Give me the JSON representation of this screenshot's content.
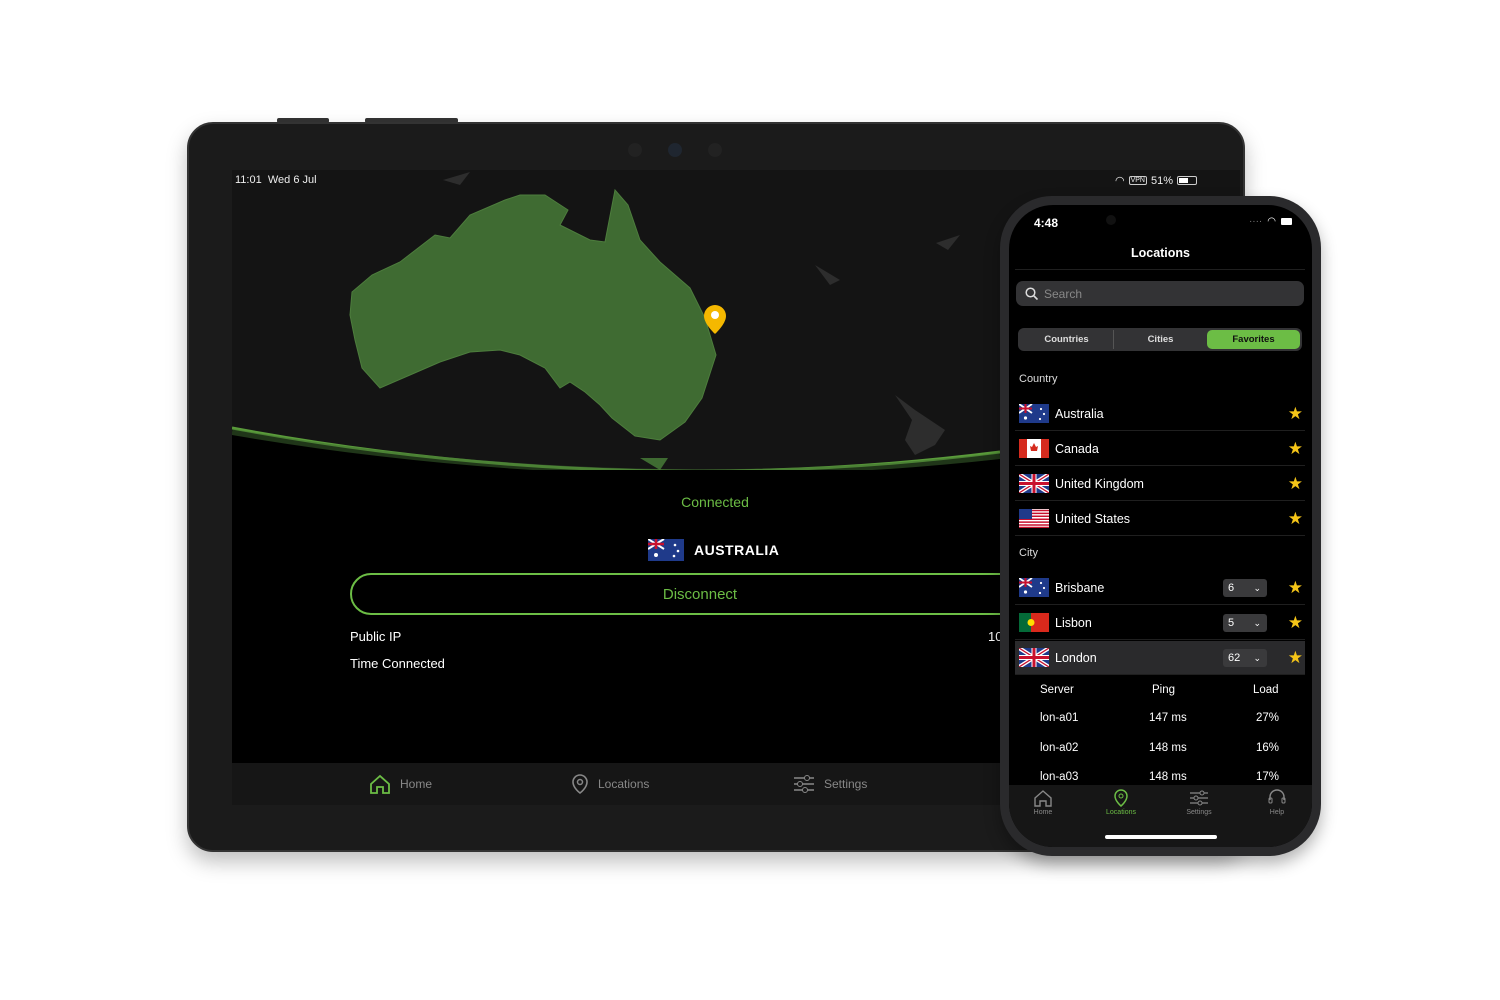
{
  "tablet": {
    "status": {
      "time": "11:01",
      "date": "Wed 6 Jul",
      "vpn": "VPN",
      "battery": "51%"
    },
    "status_text": "Connected",
    "country": "AUSTRALIA",
    "disconnect_label": "Disconnect",
    "info": [
      {
        "label": "Public IP",
        "value": "10"
      },
      {
        "label": "Time Connected",
        "value": ""
      }
    ],
    "tabs": [
      {
        "label": "Home",
        "icon": "home-icon",
        "active": true
      },
      {
        "label": "Locations",
        "icon": "pin-icon"
      },
      {
        "label": "Settings",
        "icon": "sliders-icon"
      }
    ],
    "colors": {
      "accent": "#6cbd45",
      "map_land": "#3f6b32",
      "pin": "#f5b800"
    }
  },
  "phone": {
    "status": {
      "time": "4:48"
    },
    "title": "Locations",
    "search_placeholder": "Search",
    "segments": [
      {
        "label": "Countries"
      },
      {
        "label": "Cities"
      },
      {
        "label": "Favorites",
        "active": true
      }
    ],
    "country_header": "Country",
    "countries": [
      {
        "name": "Australia",
        "flag": "au"
      },
      {
        "name": "Canada",
        "flag": "ca"
      },
      {
        "name": "United Kingdom",
        "flag": "gb"
      },
      {
        "name": "United States",
        "flag": "us"
      }
    ],
    "city_header": "City",
    "cities": [
      {
        "name": "Brisbane",
        "flag": "au",
        "count": "6"
      },
      {
        "name": "Lisbon",
        "flag": "pt",
        "count": "5"
      },
      {
        "name": "London",
        "flag": "gb",
        "count": "62",
        "expanded": true
      }
    ],
    "server_headers": {
      "server": "Server",
      "ping": "Ping",
      "load": "Load"
    },
    "servers": [
      {
        "server": "lon-a01",
        "ping": "147 ms",
        "load": "27%"
      },
      {
        "server": "lon-a02",
        "ping": "148 ms",
        "load": "16%"
      },
      {
        "server": "lon-a03",
        "ping": "148 ms",
        "load": "17%"
      }
    ],
    "tabs": [
      {
        "label": "Home"
      },
      {
        "label": "Locations",
        "active": true
      },
      {
        "label": "Settings"
      },
      {
        "label": "Help"
      }
    ]
  }
}
